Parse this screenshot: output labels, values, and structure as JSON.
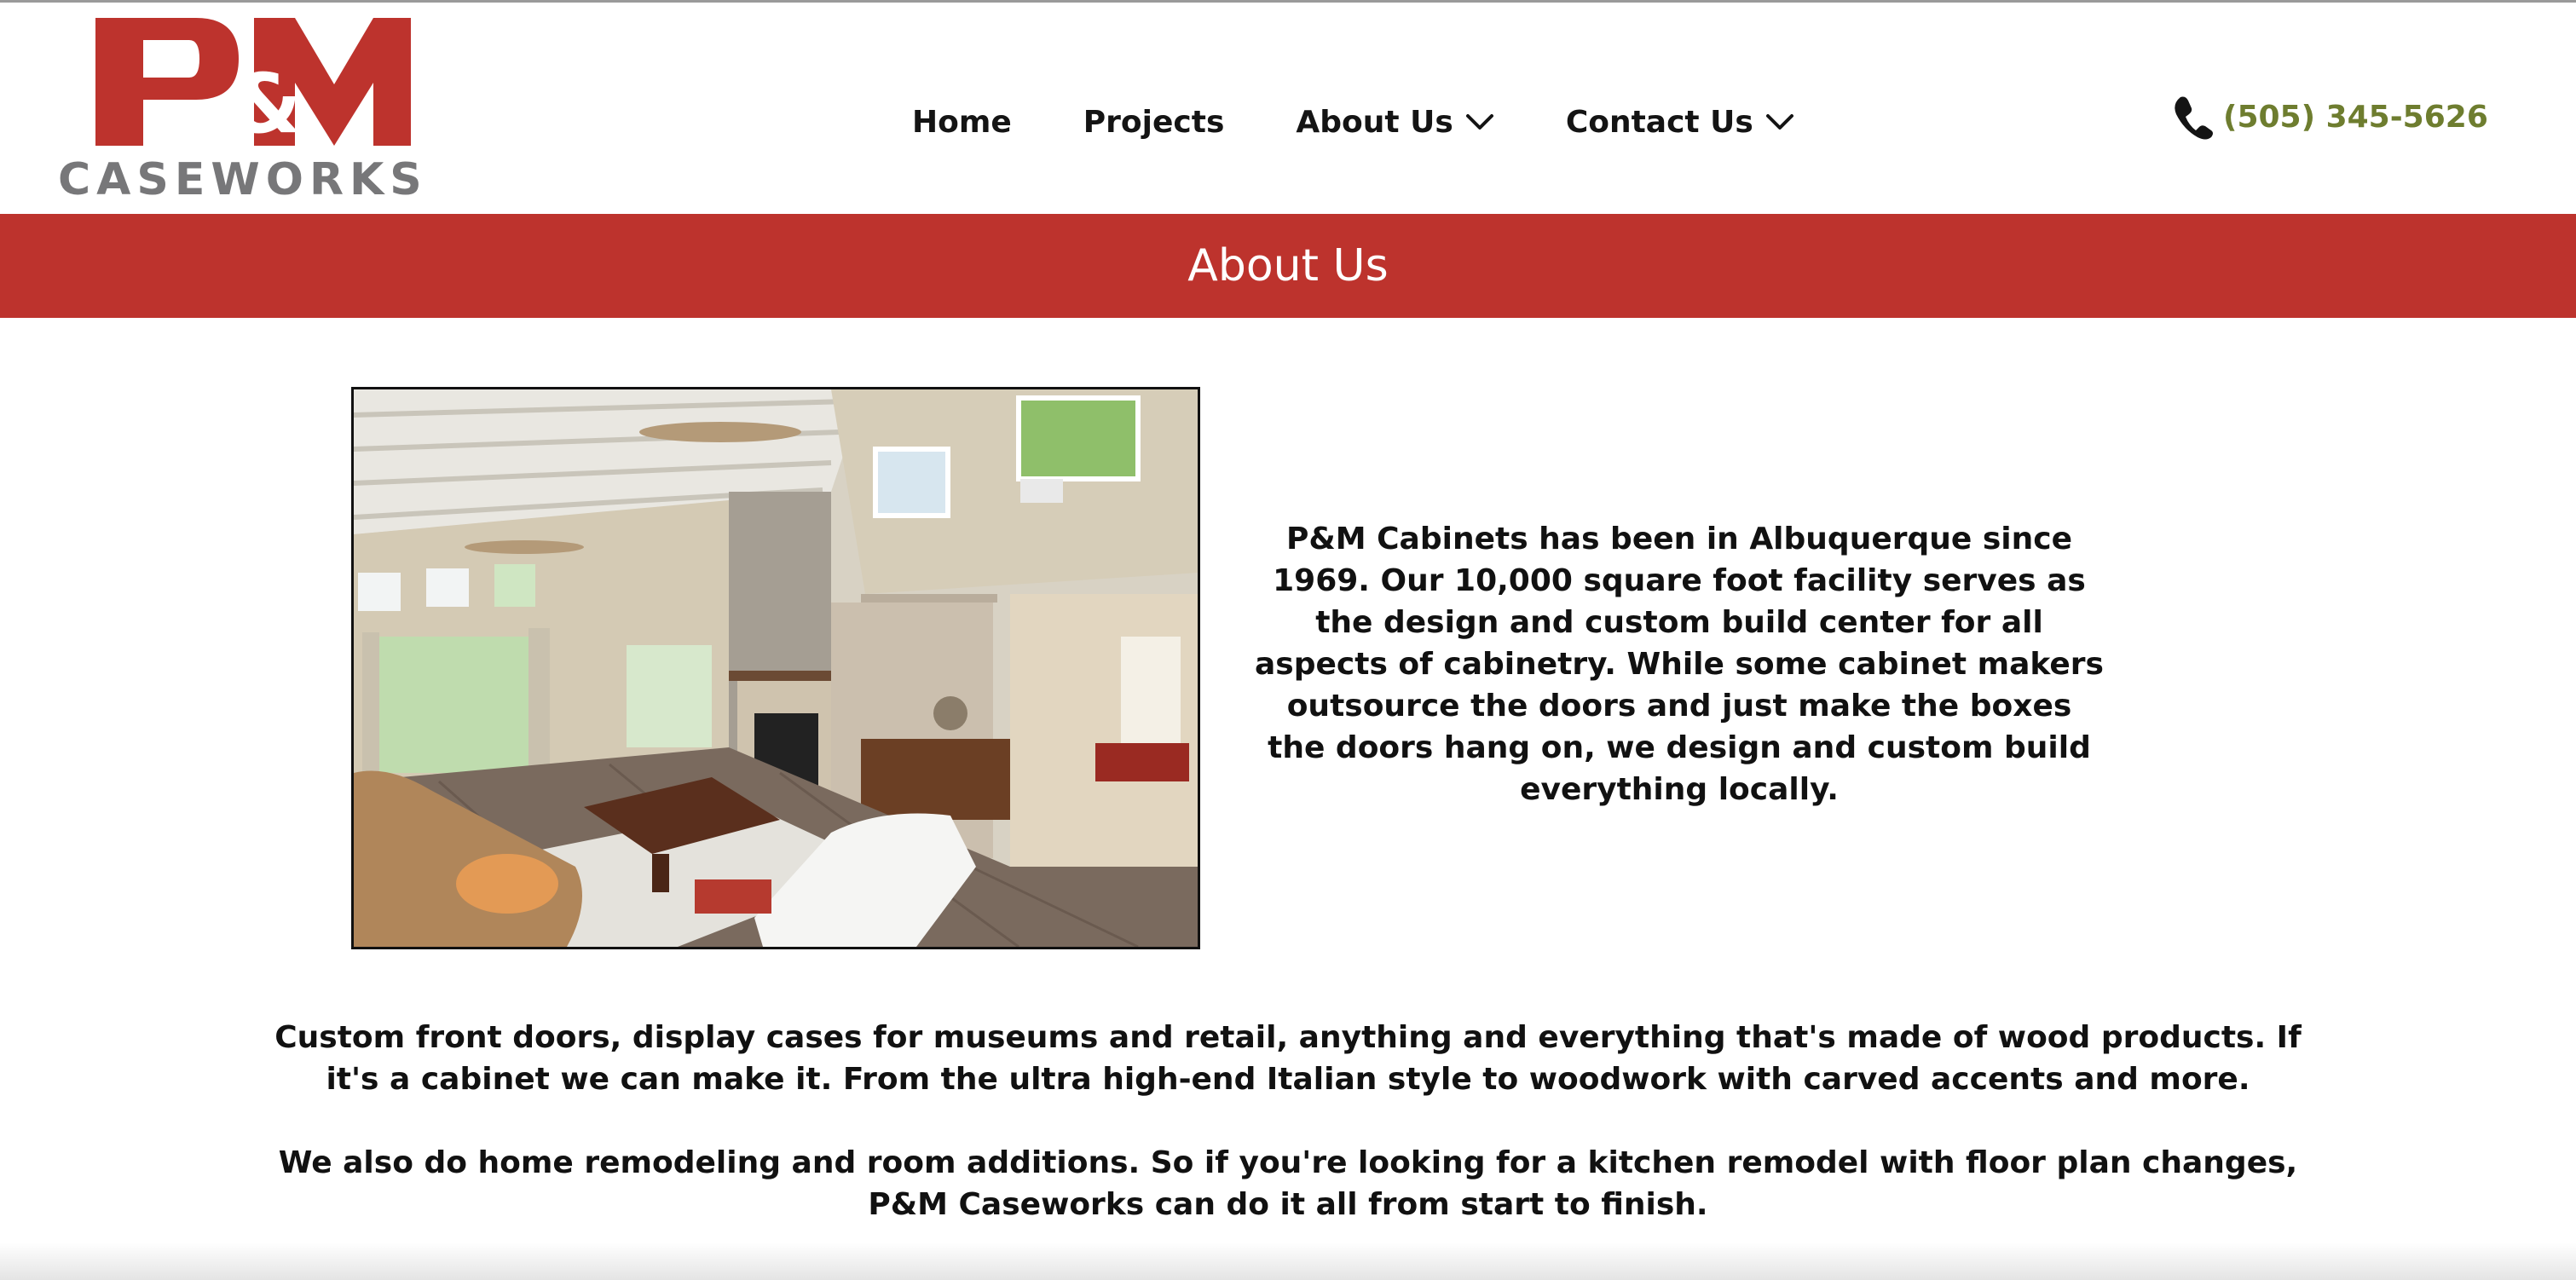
{
  "header": {
    "logo": {
      "mark": "P&M",
      "wordmark": "CASEWORKS"
    },
    "nav": [
      {
        "label": "Home",
        "has_dropdown": false
      },
      {
        "label": "Projects",
        "has_dropdown": false
      },
      {
        "label": "About Us",
        "has_dropdown": true
      },
      {
        "label": "Contact Us",
        "has_dropdown": true
      }
    ],
    "phone": {
      "icon": "phone-icon",
      "number": "(505) 345-5626"
    }
  },
  "banner": {
    "title": "About Us"
  },
  "main": {
    "photo": {
      "subject": "living-room-photo"
    },
    "intro_text": "P&M Cabinets has been in Albuquerque since 1969. Our 10,000 square foot facility serves as the design and custom build center for all aspects of cabinetry. While some cabinet makers outsource the doors and just make the boxes the doors hang on, we design and custom build everything locally.",
    "paragraph_1": "Custom front doors, display cases for museums and retail, anything and everything that's made of wood products. If it's a cabinet we can make it. From the ultra high-end Italian style to woodwork with carved accents and more.",
    "paragraph_2": "We also do home remodeling and room additions. So if you're looking for a kitchen remodel with floor plan changes, P&M Caseworks can do it all from start to finish."
  },
  "colors": {
    "brand_red": "#bd332d",
    "phone_green": "#6e7d2f",
    "wordmark_gray": "#777779"
  }
}
